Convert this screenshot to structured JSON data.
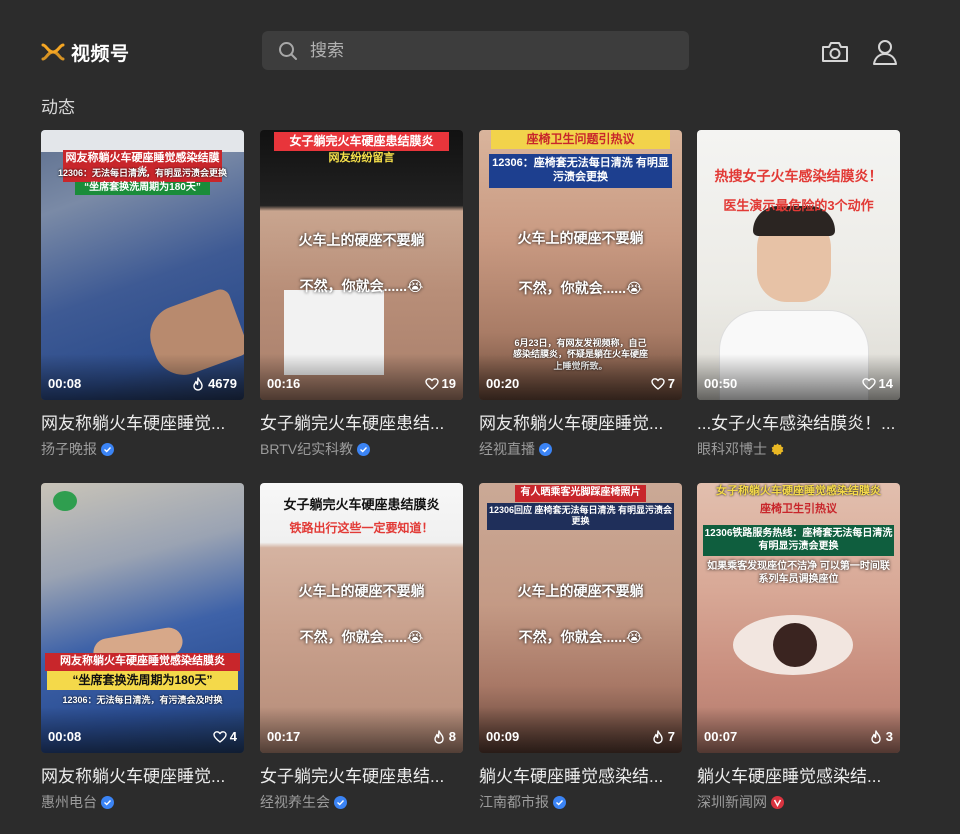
{
  "header": {
    "logo_text": "视频号",
    "search_placeholder": "搜索"
  },
  "section_title": "动态",
  "colors": {
    "background": "#2c2c2c",
    "logo_orange": "#f5a623",
    "verify_blue": "#3b84f5",
    "verify_gold": "#e9b824",
    "verify_red": "#d9333f"
  },
  "cards": [
    {
      "title": "网友称躺火车硬座睡觉...",
      "author": "扬子晚报",
      "badge": "blue",
      "duration": "00:08",
      "likes": "4679",
      "like_icon": "flame-icon",
      "overlay": [
        "网友称躺火车硬座睡觉感染结膜炎",
        "12306：无法每日清洗，有明显污渍会更换",
        "“坐席套换洗周期为180天”"
      ]
    },
    {
      "title": "女子躺完火车硬座患结...",
      "author": "BRTV纪实科教",
      "badge": "blue",
      "duration": "00:16",
      "likes": "19",
      "like_icon": "heart-icon",
      "overlay": [
        "女子躺完火车硬座患结膜炎",
        "网友纷纷留言",
        "火车上的硬座不要躺",
        "不然，你就会......😭"
      ]
    },
    {
      "title": "网友称躺火车硬座睡觉...",
      "author": "经视直播",
      "badge": "blue",
      "duration": "00:20",
      "likes": "7",
      "like_icon": "heart-icon",
      "overlay": [
        "座椅卫生问题引热议",
        "12306：座椅套无法每日清洗 有明显污渍会更换",
        "火车上的硬座不要躺",
        "不然，你就会......😭",
        "6月23日，有网友发视频称，自己感染结膜炎，怀疑是躺在火车硬座上睡觉所致。"
      ]
    },
    {
      "title": "...女子火车感染结膜炎！...",
      "author": "眼科邓博士",
      "badge": "gold",
      "duration": "00:50",
      "likes": "14",
      "like_icon": "heart-icon",
      "overlay": [
        "热搜女子火车感染结膜炎！",
        "医生演示最危险的3个动作"
      ]
    },
    {
      "title": "网友称躺火车硬座睡觉...",
      "author": "惠州电台",
      "badge": "blue",
      "duration": "00:08",
      "likes": "4",
      "like_icon": "heart-icon",
      "overlay": [
        "网友称躺火车硬座睡觉感染结膜炎",
        "“坐席套换洗周期为180天”",
        "12306：无法每日清洗，有污渍会及时换"
      ]
    },
    {
      "title": "女子躺完火车硬座患结...",
      "author": "经视养生会",
      "badge": "blue",
      "duration": "00:17",
      "likes": "8",
      "like_icon": "flame-icon",
      "overlay": [
        "女子躺完火车硬座患结膜炎",
        "铁路出行这些一定要知道！",
        "火车上的硬座不要躺",
        "不然，你就会......😭"
      ]
    },
    {
      "title": "躺火车硬座睡觉感染结...",
      "author": "江南都市报",
      "badge": "blue",
      "duration": "00:09",
      "likes": "7",
      "like_icon": "flame-icon",
      "overlay": [
        "有人晒乘客光脚踩座椅照片",
        "12306回应 座椅套无法每日清洗 有明显污渍会更换",
        "火车上的硬座不要躺",
        "不然，你就会......😭"
      ]
    },
    {
      "title": "躺火车硬座睡觉感染结...",
      "author": "深圳新闻网",
      "badge": "red",
      "duration": "00:07",
      "likes": "3",
      "like_icon": "flame-icon",
      "overlay": [
        "女子称躺火车硬座睡觉感染结膜炎",
        "座椅卫生引热议",
        "12306铁路服务热线：座椅套无法每日清洗 有明显污渍会更换",
        "如果乘客发现座位不洁净 可以第一时间联系列车员调换座位"
      ]
    }
  ]
}
